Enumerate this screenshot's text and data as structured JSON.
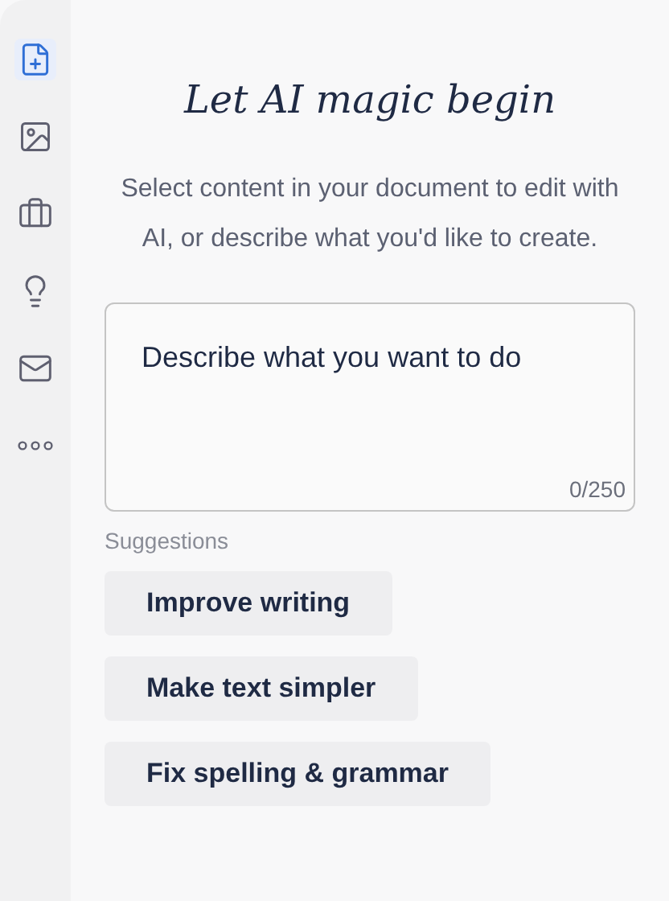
{
  "sidebar": {
    "items": [
      {
        "selected": true
      },
      {
        "selected": false
      },
      {
        "selected": false
      },
      {
        "selected": false
      },
      {
        "selected": false
      },
      {
        "selected": false
      }
    ]
  },
  "heading": "Let AI magic begin",
  "description": "Select content in your document to edit with AI, or describe what you'd like to create.",
  "prompt": {
    "placeholder": "Describe what you want to do",
    "counter": "0/250"
  },
  "suggestions": {
    "label": "Suggestions",
    "items": [
      "Improve writing",
      "Make text simpler",
      "Fix spelling & grammar"
    ]
  }
}
